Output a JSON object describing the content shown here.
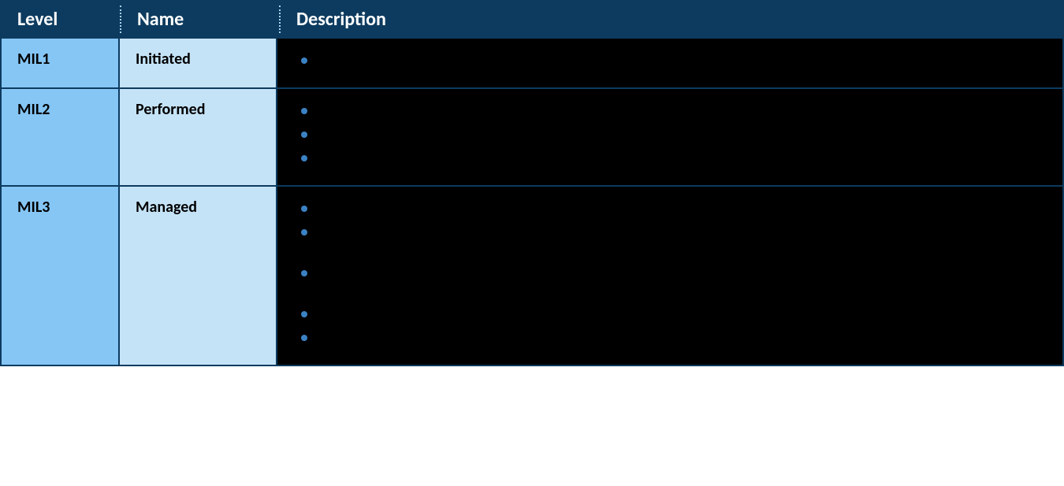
{
  "header": {
    "level": "Level",
    "name": "Name",
    "description": "Description"
  },
  "rows": [
    {
      "level": "MIL1",
      "name": "Initiated",
      "bullets": [
        ""
      ]
    },
    {
      "level": "MIL2",
      "name": "Performed",
      "bullets": [
        "",
        "",
        ""
      ]
    },
    {
      "level": "MIL3",
      "name": "Managed",
      "bullets": [
        "",
        "",
        "",
        "",
        ""
      ]
    }
  ]
}
